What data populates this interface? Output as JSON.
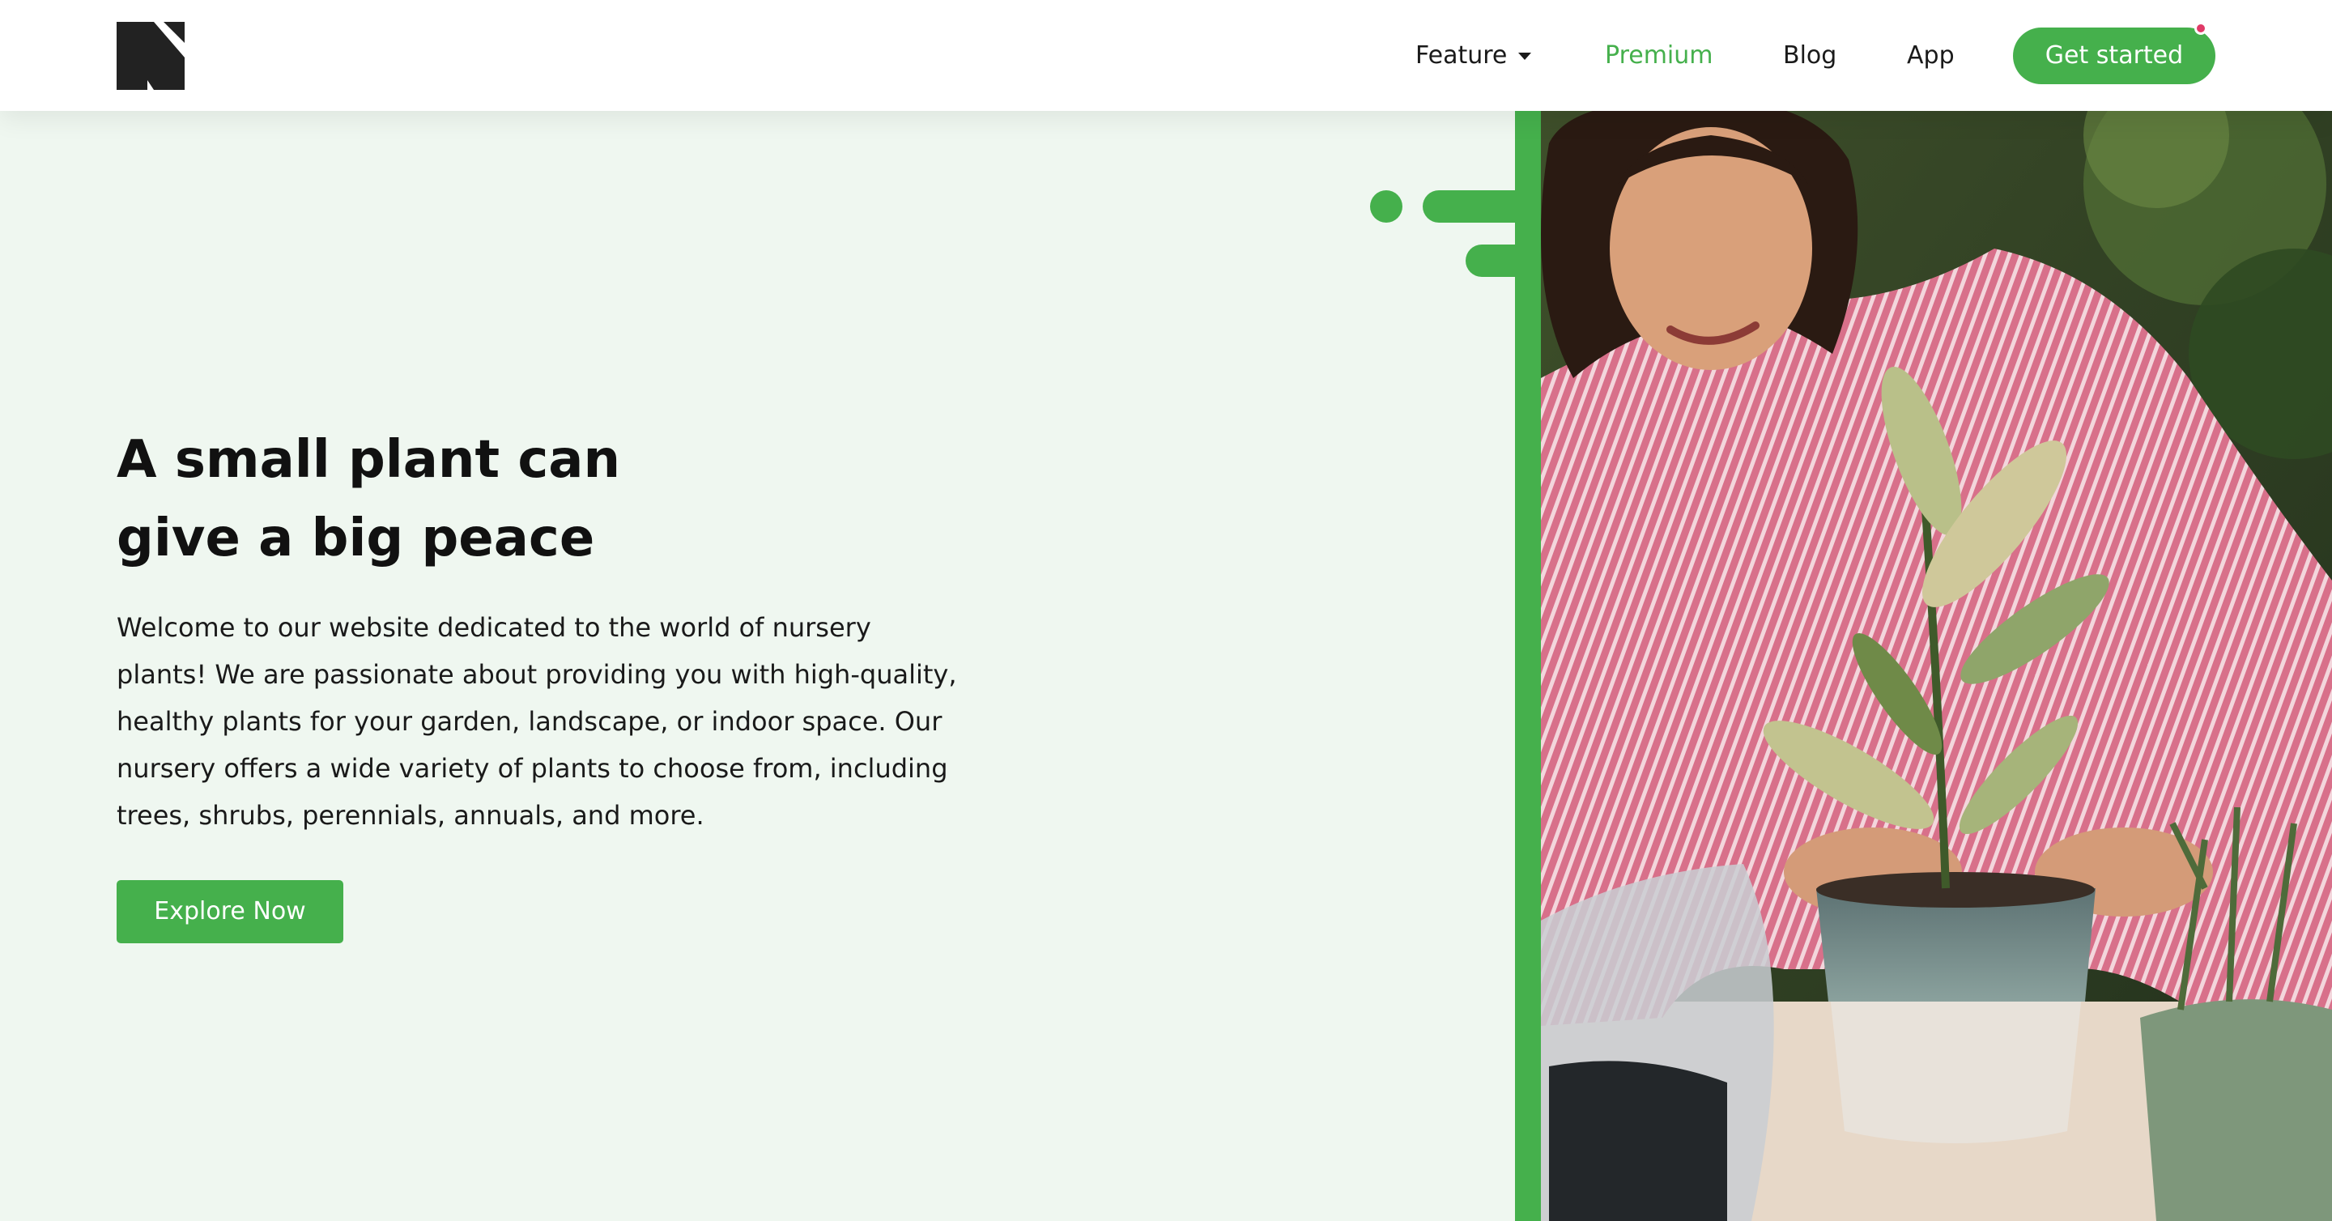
{
  "colors": {
    "accent": "#45b04c",
    "background": "#eff7f0",
    "text": "#111111",
    "notification": "#e03a67"
  },
  "header": {
    "logo_icon": "brand-n-logo",
    "nav": {
      "feature": "Feature",
      "premium": "Premium",
      "blog": "Blog",
      "app": "App"
    },
    "cta_label": "Get started"
  },
  "hero": {
    "title_line1": "A small plant can",
    "title_line2": "give a big peace",
    "description": "Welcome to our website dedicated to the world of nursery plants! We are passionate about providing you with high-quality, healthy plants for your garden, landscape, or indoor space. Our nursery offers a wide variety of plants to choose from, including trees, shrubs, perennials, annuals, and more.",
    "button_label": "Explore Now"
  }
}
